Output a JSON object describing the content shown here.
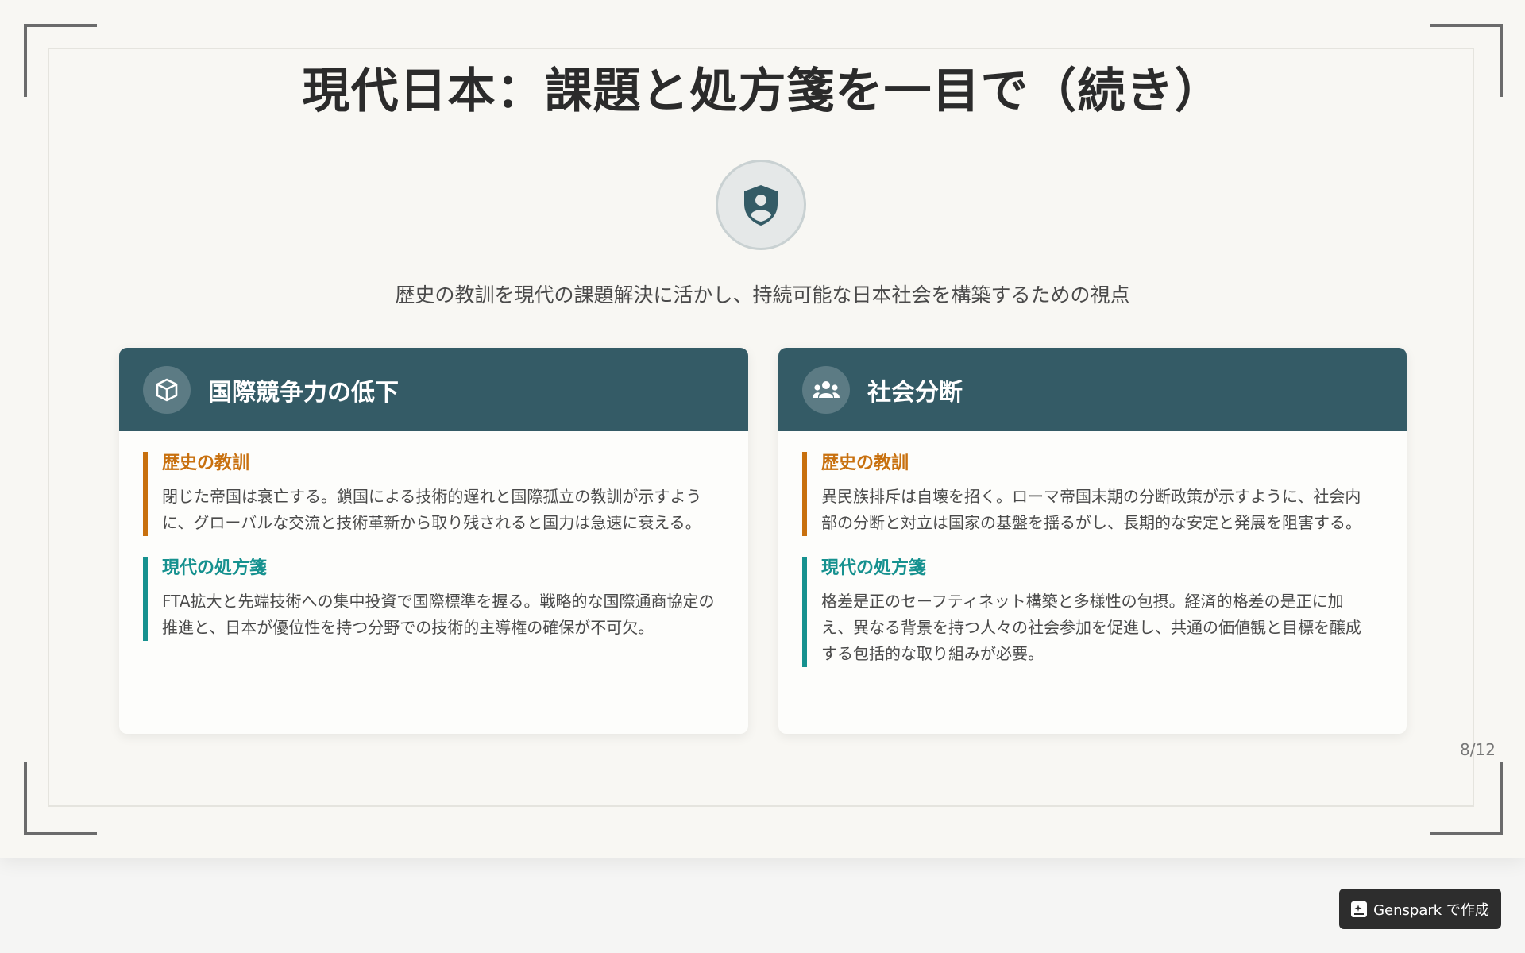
{
  "slide": {
    "title": "現代日本：課題と処方箋を一目で（続き）",
    "subtitle": "歴史の教訓を現代の課題解決に活かし、持続可能な日本社会を構築するための視点",
    "hero_icon": "user-shield-icon",
    "page_number": "8/12"
  },
  "cards": [
    {
      "icon": "cube-icon",
      "title": "国際競争力の低下",
      "lesson_label": "歴史の教訓",
      "lesson_text": "閉じた帝国は衰亡する。鎖国による技術的遅れと国際孤立の教訓が示すように、グローバルな交流と技術革新から取り残されると国力は急速に衰える。",
      "remedy_label": "現代の処方箋",
      "remedy_text": "FTA拡大と先端技術への集中投資で国際標準を握る。戦略的な国際通商協定の推進と、日本が優位性を持つ分野での技術的主導権の確保が不可欠。"
    },
    {
      "icon": "users-icon",
      "title": "社会分断",
      "lesson_label": "歴史の教訓",
      "lesson_text": "異民族排斥は自壊を招く。ローマ帝国末期の分断政策が示すように、社会内部の分断と対立は国家の基盤を揺るがし、長期的な安定と発展を阻害する。",
      "remedy_label": "現代の処方箋",
      "remedy_text": "格差是正のセーフティネット構築と多様性の包摂。経済的格差の是正に加え、異なる背景を持つ人々の社会参加を促進し、共通の価値観と目標を醸成する包括的な取り組みが必要。"
    }
  ],
  "genspark_button": {
    "label": "Genspark で作成"
  },
  "colors": {
    "header": "#345b66",
    "lesson_accent": "#c8700e",
    "remedy_accent": "#16918f"
  }
}
